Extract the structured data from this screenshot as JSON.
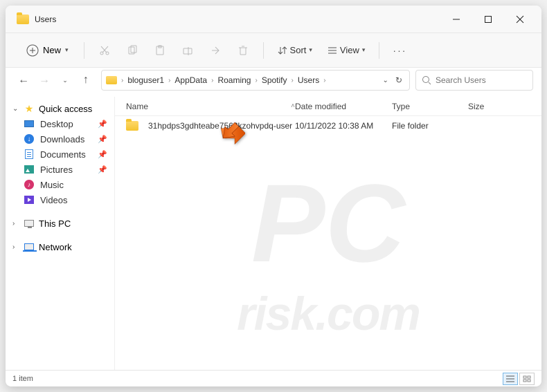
{
  "window": {
    "title": "Users"
  },
  "toolbar": {
    "new_label": "New",
    "sort_label": "Sort",
    "view_label": "View"
  },
  "breadcrumbs": [
    "bloguser1",
    "AppData",
    "Roaming",
    "Spotify",
    "Users"
  ],
  "search": {
    "placeholder": "Search Users"
  },
  "sidebar": {
    "quick_access": "Quick access",
    "items": [
      {
        "label": "Desktop",
        "pinned": true
      },
      {
        "label": "Downloads",
        "pinned": true
      },
      {
        "label": "Documents",
        "pinned": true
      },
      {
        "label": "Pictures",
        "pinned": true
      },
      {
        "label": "Music",
        "pinned": false
      },
      {
        "label": "Videos",
        "pinned": false
      }
    ],
    "this_pc": "This PC",
    "network": "Network"
  },
  "columns": {
    "name": "Name",
    "date": "Date modified",
    "type": "Type",
    "size": "Size"
  },
  "rows": [
    {
      "name": "31hpdps3gdhteabe7562kzohvpdq-user",
      "date": "10/11/2022 10:38 AM",
      "type": "File folder",
      "size": ""
    }
  ],
  "status": {
    "count": "1 item"
  },
  "watermark": {
    "logo": "PC",
    "text": "risk.com"
  }
}
